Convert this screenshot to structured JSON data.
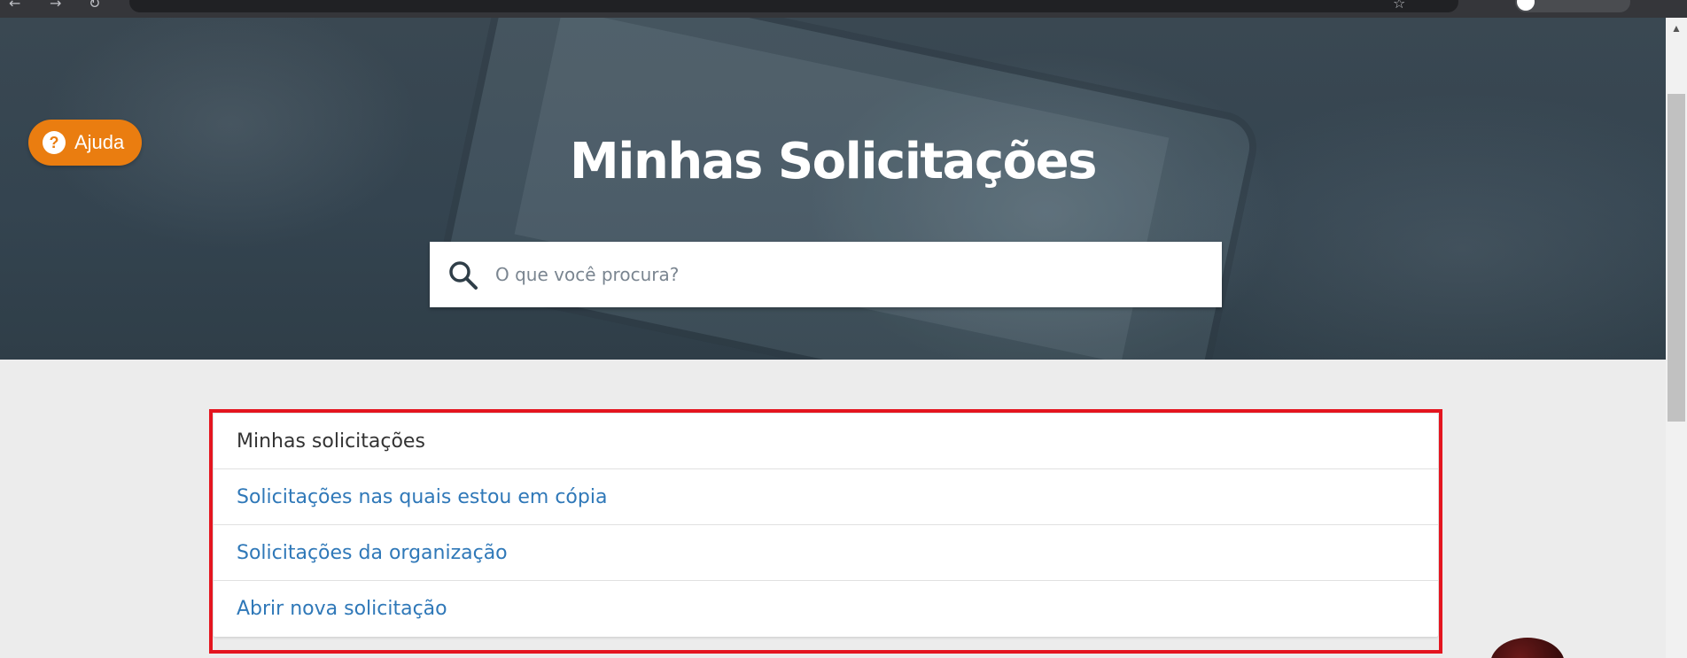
{
  "hero": {
    "title": "Minhas Solicitações",
    "search": {
      "placeholder": "O que você procura?",
      "value": ""
    }
  },
  "help_button": {
    "icon": "question-icon",
    "icon_glyph": "?",
    "label": "Ajuda",
    "color": "#ea7d10"
  },
  "nav": {
    "items": [
      {
        "label": "Minhas solicitações",
        "active": true
      },
      {
        "label": "Solicitações nas quais estou em cópia",
        "active": false
      },
      {
        "label": "Solicitações da organização",
        "active": false
      },
      {
        "label": "Abrir nova solicitação",
        "active": false
      }
    ],
    "highlight_color": "#e4151f",
    "link_color": "#2f78b8"
  },
  "scrollbar": {
    "up_glyph": "▲"
  }
}
